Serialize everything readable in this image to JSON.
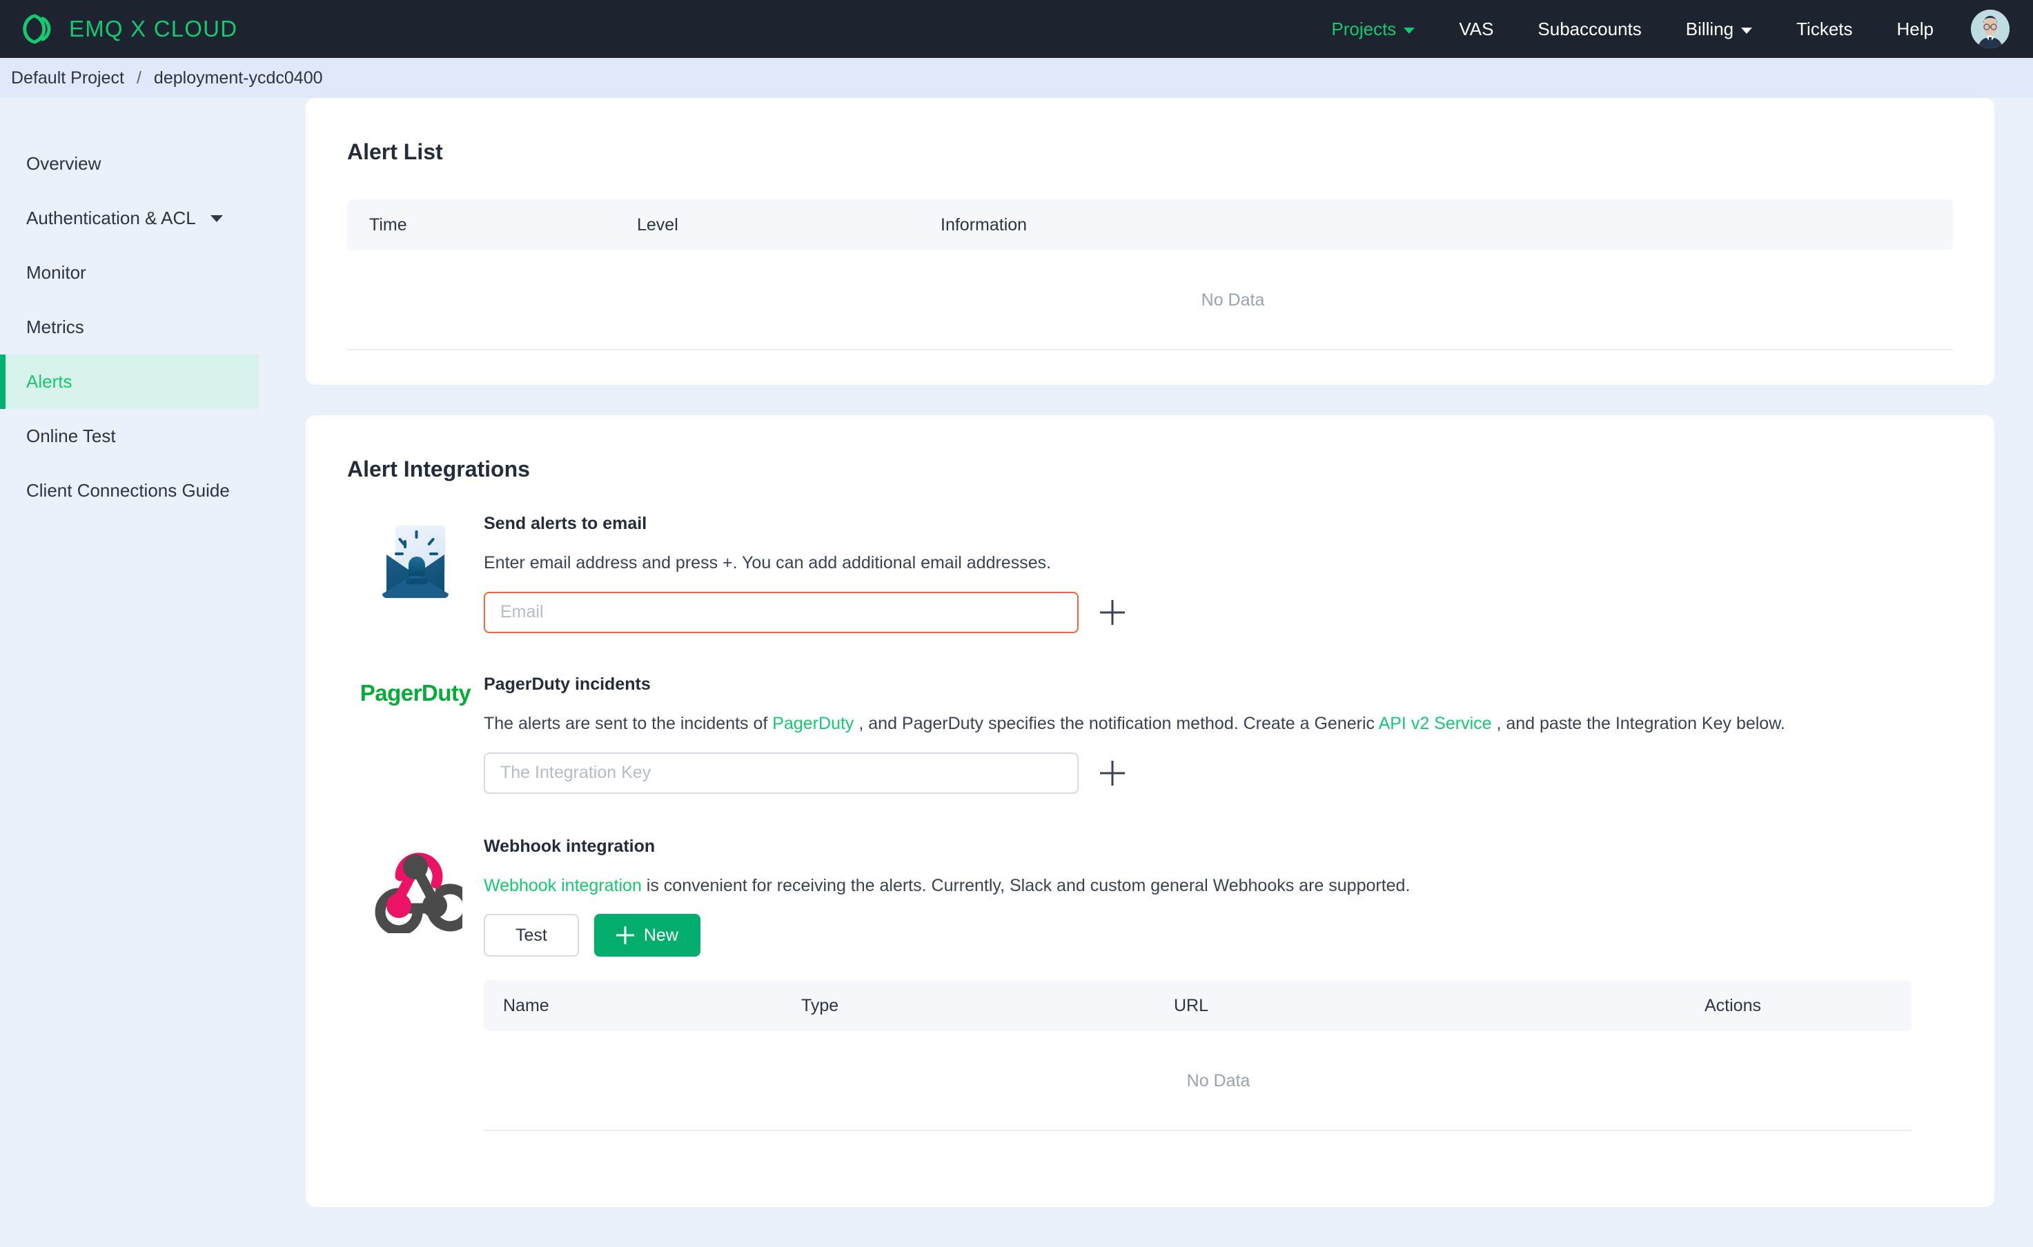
{
  "topnav": {
    "brand": "EMQ X CLOUD",
    "brand_icon": "emqx-logo-icon",
    "items": [
      {
        "label": "Projects",
        "active": true,
        "caret": true
      },
      {
        "label": "VAS",
        "active": false,
        "caret": false
      },
      {
        "label": "Subaccounts",
        "active": false,
        "caret": false
      },
      {
        "label": "Billing",
        "active": false,
        "caret": true
      },
      {
        "label": "Tickets",
        "active": false,
        "caret": false
      },
      {
        "label": "Help",
        "active": false,
        "caret": false
      }
    ],
    "avatar": "user-avatar"
  },
  "breadcrumb": {
    "project": "Default Project",
    "separator": "/",
    "deployment": "deployment-ycdc0400"
  },
  "sidebar": {
    "items": [
      {
        "label": "Overview",
        "active": false,
        "caret": false
      },
      {
        "label": "Authentication & ACL",
        "active": false,
        "caret": true
      },
      {
        "label": "Monitor",
        "active": false,
        "caret": false
      },
      {
        "label": "Metrics",
        "active": false,
        "caret": false
      },
      {
        "label": "Alerts",
        "active": true,
        "caret": false
      },
      {
        "label": "Online Test",
        "active": false,
        "caret": false
      },
      {
        "label": "Client Connections Guide",
        "active": false,
        "caret": false
      }
    ]
  },
  "alert_list": {
    "title": "Alert List",
    "columns": [
      "Time",
      "Level",
      "Information"
    ],
    "rows": [],
    "empty_text": "No Data"
  },
  "alert_integrations": {
    "title": "Alert Integrations",
    "email": {
      "icon": "email-alert-icon",
      "title": "Send alerts to email",
      "description": "Enter email address and press +. You can add additional email addresses.",
      "input_value": "",
      "input_placeholder": "Email",
      "input_state": "error",
      "add_icon": "plus-icon"
    },
    "pagerduty": {
      "icon": "pagerduty-logo-icon",
      "logo_text": "PagerDuty",
      "title": "PagerDuty incidents",
      "desc_part1": "The alerts are sent to the incidents of ",
      "desc_link1": "PagerDuty",
      "desc_part2": " , and PagerDuty specifies the notification method. Create a Generic ",
      "desc_link2": "API v2 Service",
      "desc_part3": " , and paste the Integration Key below.",
      "input_value": "",
      "input_placeholder": "The Integration Key",
      "add_icon": "plus-icon"
    },
    "webhook": {
      "icon": "webhook-logo-icon",
      "title": "Webhook integration",
      "desc_link": "Webhook integration",
      "desc_rest": " is convenient for receiving the alerts. Currently, Slack and custom general Webhooks are supported.",
      "test_label": "Test",
      "new_label": "New",
      "new_icon": "plus-icon",
      "columns": [
        "Name",
        "Type",
        "URL",
        "Actions"
      ],
      "rows": [],
      "empty_text": "No Data"
    }
  },
  "colors": {
    "brand_green": "#15c971",
    "primary_green": "#03ad6e",
    "nav_dark": "#1d2430",
    "page_bg": "#ebf1fb",
    "breadcrumb_bg": "#dfe9f7",
    "error_border": "#f2643c",
    "webhook_pink": "#ec1266",
    "webhook_gray": "#4b4b4b"
  }
}
